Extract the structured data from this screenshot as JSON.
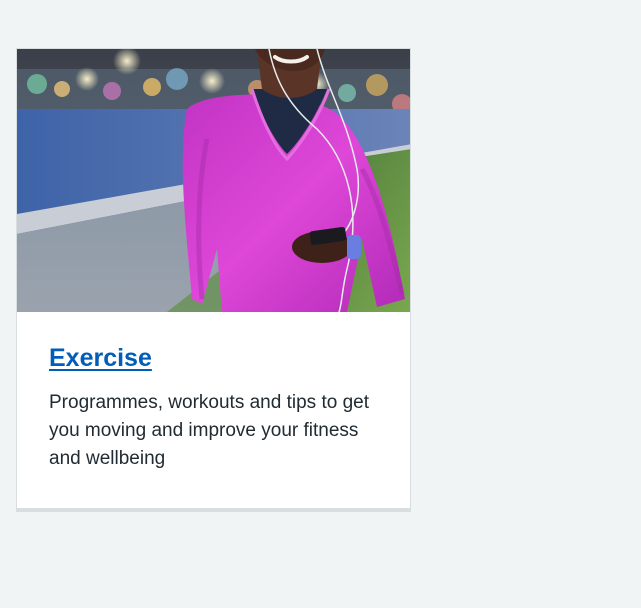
{
  "card": {
    "title": "Exercise",
    "description": "Programmes, workouts and tips to get you moving and improve your fitness and wellbeing",
    "image_subject": "woman-running-with-earphones",
    "colors": {
      "link": "#005eb8",
      "text": "#212b32",
      "page_background": "#f0f4f5",
      "card_border": "#d8dde0",
      "jacket": "#d63bd0"
    }
  }
}
